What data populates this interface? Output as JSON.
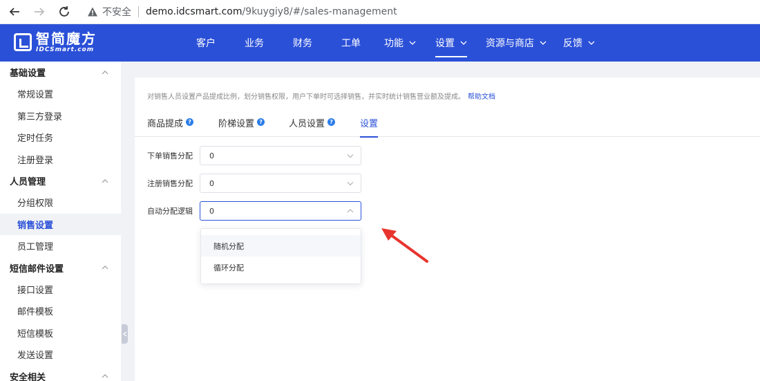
{
  "browser": {
    "insecure_label": "不安全",
    "url_host": "demo.idcsmart.com",
    "url_path": "/9kuygiy8/#/sales-management"
  },
  "logo": {
    "name_cn": "智简魔方",
    "name_en": "IDCSmart.com"
  },
  "topnav": {
    "items": [
      {
        "label": "客户"
      },
      {
        "label": "业务"
      },
      {
        "label": "财务"
      },
      {
        "label": "工单"
      },
      {
        "label": "功能"
      },
      {
        "label": "设置"
      },
      {
        "label": "资源与商店"
      },
      {
        "label": "反馈"
      }
    ],
    "active": "设置"
  },
  "sidebar": {
    "groups": [
      {
        "title": "基础设置",
        "items": [
          "常规设置",
          "第三方登录",
          "定时任务",
          "注册登录"
        ]
      },
      {
        "title": "人员管理",
        "items": [
          "分组权限",
          "销售设置",
          "员工管理"
        ]
      },
      {
        "title": "短信邮件设置",
        "items": [
          "接口设置",
          "邮件模板",
          "短信模板",
          "发送设置"
        ]
      },
      {
        "title": "安全相关",
        "items": []
      }
    ],
    "active_item": "销售设置"
  },
  "main": {
    "description": "对销售人员设置产品提成比例，划分销售权限，用户下单时可选择销售，并实时统计销售营业额及提成。",
    "help_link": "帮助文档",
    "tabs": [
      {
        "label": "商品提成",
        "help": true
      },
      {
        "label": "阶梯设置",
        "help": true
      },
      {
        "label": "人员设置",
        "help": true
      },
      {
        "label": "设置",
        "help": false
      }
    ],
    "active_tab": "设置",
    "form": [
      {
        "label": "下单销售分配",
        "value": "0"
      },
      {
        "label": "注册销售分配",
        "value": "0"
      },
      {
        "label": "自动分配逻辑",
        "value": "0"
      }
    ],
    "dropdown_options": [
      "随机分配",
      "循环分配"
    ],
    "help_glyph": "?"
  },
  "colors": {
    "primary": "#2b50d8",
    "annotation_arrow": "#e8342e"
  }
}
